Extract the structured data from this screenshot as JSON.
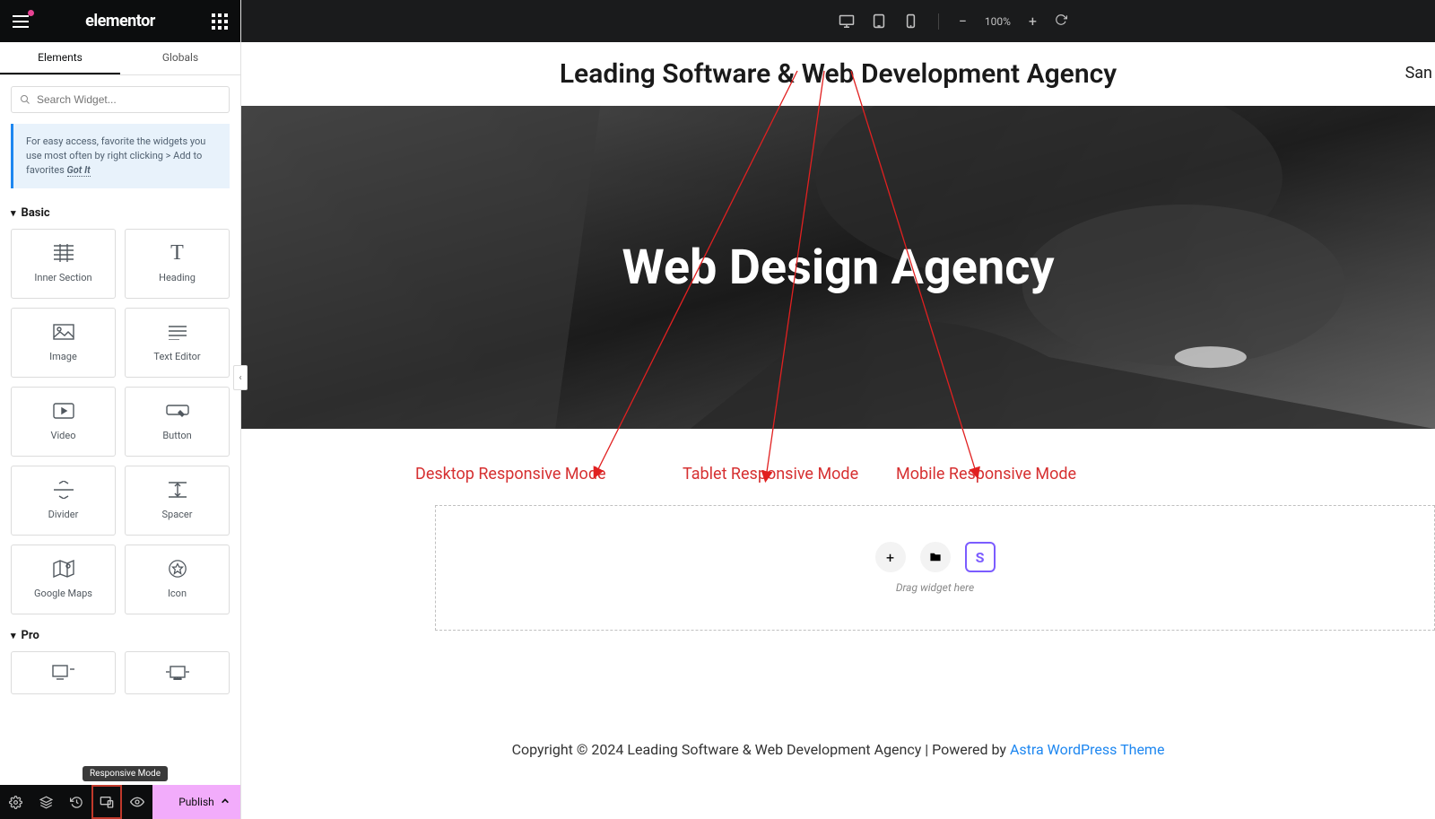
{
  "sidebar": {
    "logo": "elementor",
    "tabs": {
      "elements": "Elements",
      "globals": "Globals"
    },
    "search_placeholder": "Search Widget...",
    "tip": {
      "text": "For easy access, favorite the widgets you use most often by right clicking > Add to favorites ",
      "gotit": "Got It"
    },
    "categories": [
      {
        "name": "Basic",
        "widgets": [
          {
            "id": "inner-section",
            "label": "Inner Section",
            "icon": "inner-section"
          },
          {
            "id": "heading",
            "label": "Heading",
            "icon": "heading"
          },
          {
            "id": "image",
            "label": "Image",
            "icon": "image"
          },
          {
            "id": "text-editor",
            "label": "Text Editor",
            "icon": "text-editor"
          },
          {
            "id": "video",
            "label": "Video",
            "icon": "video"
          },
          {
            "id": "button",
            "label": "Button",
            "icon": "button"
          },
          {
            "id": "divider",
            "label": "Divider",
            "icon": "divider"
          },
          {
            "id": "spacer",
            "label": "Spacer",
            "icon": "spacer"
          },
          {
            "id": "google-maps",
            "label": "Google Maps",
            "icon": "map"
          },
          {
            "id": "icon",
            "label": "Icon",
            "icon": "star"
          }
        ]
      },
      {
        "name": "Pro",
        "widgets": [
          {
            "id": "pro-1",
            "label": "",
            "icon": "pro-a"
          },
          {
            "id": "pro-2",
            "label": "",
            "icon": "pro-b"
          }
        ]
      }
    ],
    "footer": {
      "tooltip": "Responsive Mode",
      "publish": "Publish"
    }
  },
  "topbar": {
    "zoom": "100%",
    "devices": [
      "desktop",
      "tablet",
      "mobile"
    ]
  },
  "canvas": {
    "page_title": "Leading Software & Web Development Agency",
    "top_right_partial": "San",
    "hero_heading": "Web Design Agency",
    "annotations": {
      "desktop": "Desktop Responsive Mode",
      "tablet": "Tablet Responsive Mode",
      "mobile": "Mobile Responsive Mode"
    },
    "drop_hint": "Drag widget here",
    "drop_button_s": "S",
    "footer_text_a": "Copyright © 2024 Leading Software & Web Development Agency | Powered by ",
    "footer_text_link": "Astra WordPress Theme"
  }
}
